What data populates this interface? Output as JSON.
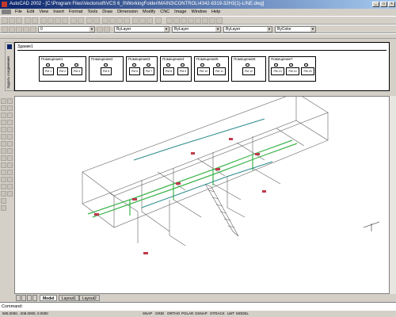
{
  "window": {
    "title": "AutoCAD 2002 - [C:\\Program Files\\Vectorsoft\\VCS 6_0\\WorkingFolder\\MAIN3\\CONTROL\\4342-8319-32H3(1)-LINE.dwg]"
  },
  "menu": [
    "File",
    "Edit",
    "View",
    "Insert",
    "Format",
    "Tools",
    "Draw",
    "Dimension",
    "Modify",
    "CNC",
    "Image",
    "Window",
    "Help"
  ],
  "toolbar": {
    "layer_value": "0",
    "color_value": "ByLayer",
    "linetype_value": "ByLayer",
    "lineweight_value": "ByLayer",
    "plotstyle_value": "ByColor"
  },
  "palette": {
    "side_label": "Задать соединения",
    "building": "Здание1",
    "rooms": [
      {
        "name": "Помещение1",
        "units": [
          "PM 1",
          "PM 2",
          "PM 4"
        ]
      },
      {
        "name": "Помещение2",
        "units": [
          "PM 5"
        ]
      },
      {
        "name": "Помещение3",
        "units": [
          "PM 6",
          "PM 7"
        ]
      },
      {
        "name": "Помещение4",
        "units": [
          "PM 8",
          "PM 9"
        ]
      },
      {
        "name": "Помещение5",
        "units": [
          "PM 10",
          "PM 11"
        ]
      },
      {
        "name": "Помещение6",
        "units": [
          "PM 12"
        ]
      },
      {
        "name": "Помещение7",
        "units": [
          "PM 13",
          "PM 14",
          "PM 15"
        ]
      }
    ]
  },
  "tabs": [
    "Model",
    "Layout1",
    "Layout2"
  ],
  "command": {
    "prompt": "Command:"
  },
  "status": {
    "coords": "505.0000, -208.0000, 0.0000",
    "toggles": [
      "SNAP",
      "GRID",
      "ORTHO",
      "POLAR",
      "OSNAP",
      "OTRACK",
      "LWT",
      "MODEL"
    ]
  }
}
